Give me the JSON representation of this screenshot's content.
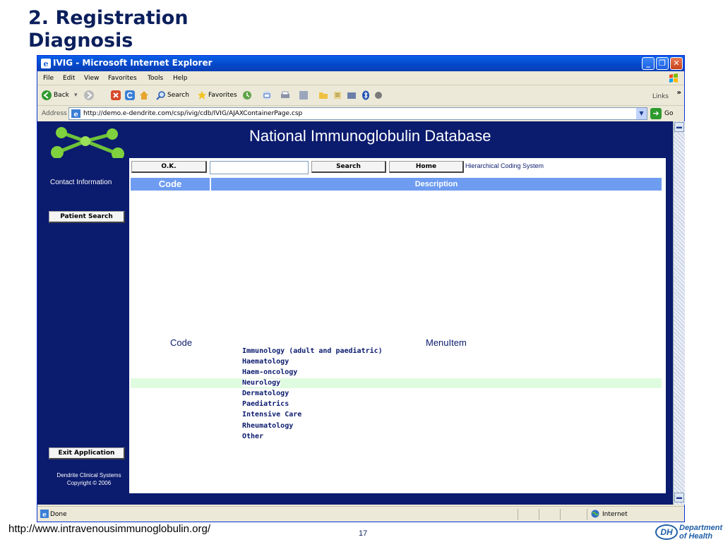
{
  "slide": {
    "title": "2. Registration\nDiagnosis",
    "url": "http://www.intravenousimmunoglobulin.org/",
    "page_number": "17",
    "logo": {
      "mark": "DH",
      "text": "Department of Health"
    }
  },
  "window": {
    "title": "IVIG - Microsoft Internet Explorer",
    "controls": {
      "minimize": "_",
      "maximize": "❐",
      "close": "✕"
    }
  },
  "menu": [
    "File",
    "Edit",
    "View",
    "Favorites",
    "Tools",
    "Help"
  ],
  "toolbar": {
    "back": "Back",
    "search": "Search",
    "favorites": "Favorites",
    "links": "Links",
    "more": "»"
  },
  "address": {
    "label": "Address",
    "url": "http://demo.e-dendrite.com/csp/ivig/cdb/IVIG/AJAXContainerPage.csp",
    "go": "Go"
  },
  "site": {
    "title": "National Immunoglobulin Database",
    "contact": "Contact Information",
    "patient_search": "Patient Search",
    "exit": "Exit Application",
    "footer_line1": "Dendrite Clinical Systems",
    "footer_line2": "Copyright © 2006"
  },
  "actions": {
    "ok": "O.K.",
    "search": "Search",
    "home": "Home",
    "search_value": "",
    "hierarchical": "Hierarchical Coding System"
  },
  "table": {
    "code_header": "Code",
    "description_header": "Description"
  },
  "menu_list": {
    "code_header": "Code",
    "menu_header": "MenuItem",
    "items": [
      "Immunology (adult and paediatric)",
      "Haematology",
      "Haem-oncology",
      "Neurology",
      "Dermatology",
      "Paediatrics",
      "Intensive Care",
      "Rheumatology",
      "Other"
    ],
    "highlighted": "Neurology"
  },
  "status": {
    "text": "Done",
    "zone": "Internet"
  },
  "colors": {
    "page_bg": "#0b1b6e",
    "header_blue": "#6e9cf0",
    "highlight": "#e0fce0",
    "xp_title": "#0447c8"
  }
}
